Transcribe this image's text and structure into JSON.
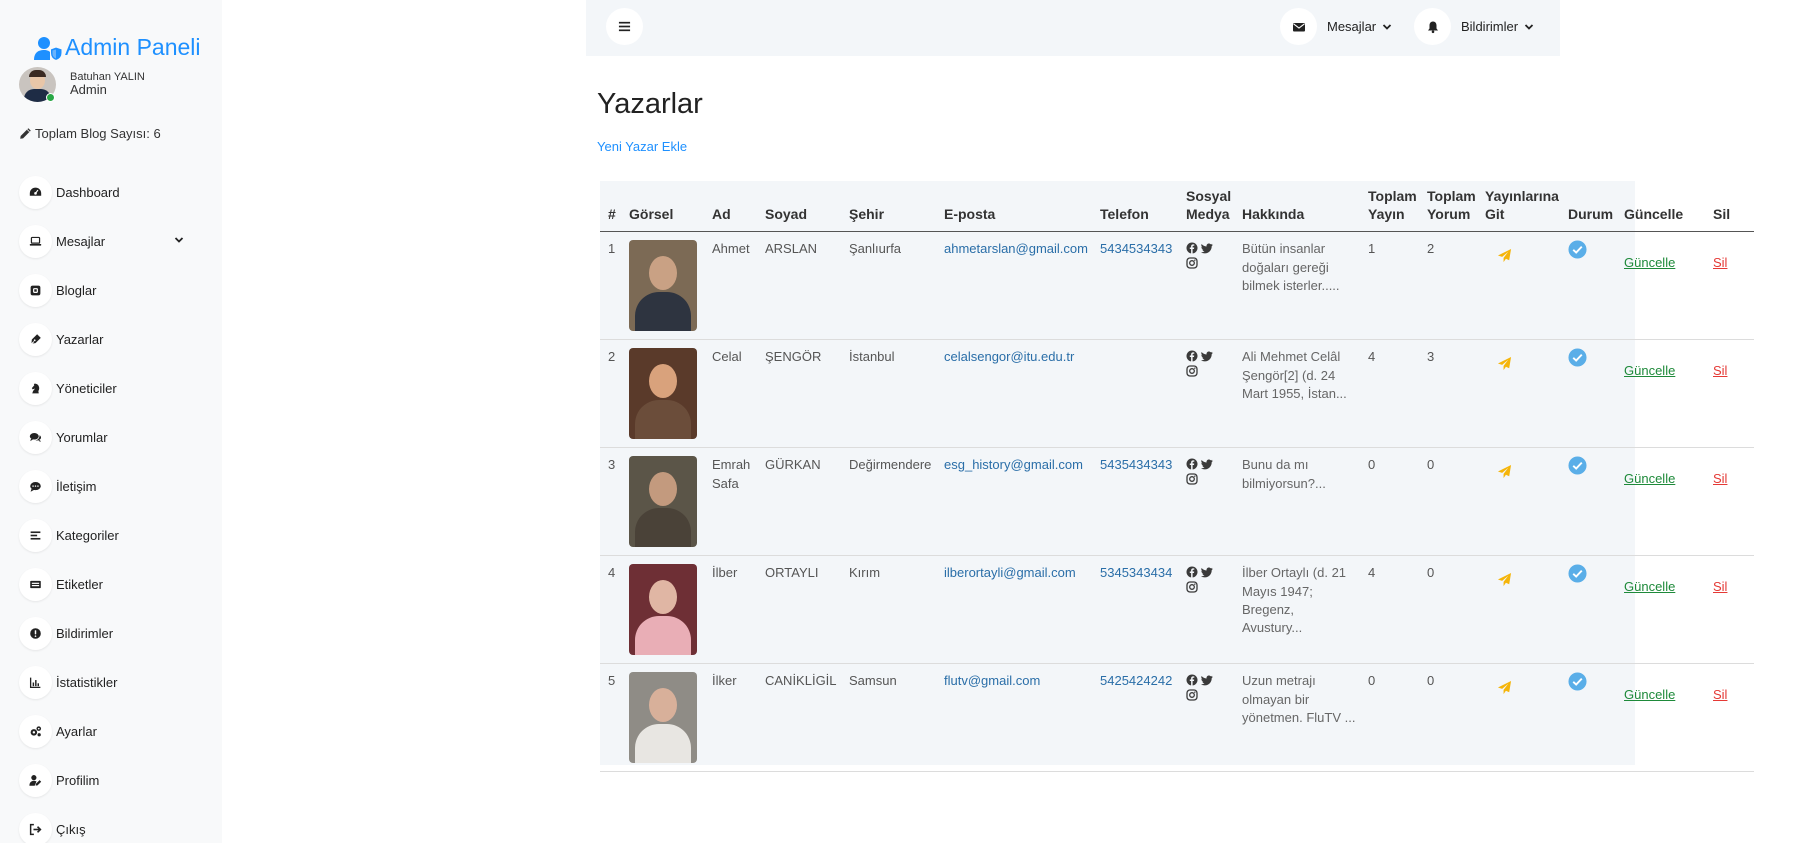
{
  "sidebar": {
    "brand": "Admin Paneli",
    "user": {
      "name": "Batuhan YALIN",
      "role": "Admin"
    },
    "blog_count": "Toplam Blog Sayısı: 6",
    "items": [
      {
        "label": "Dashboard",
        "icon": "dashboard-icon"
      },
      {
        "label": "Mesajlar",
        "icon": "laptop-icon",
        "has_chevron": true
      },
      {
        "label": "Bloglar",
        "icon": "blog-icon"
      },
      {
        "label": "Yazarlar",
        "icon": "pen-icon"
      },
      {
        "label": "Yöneticiler",
        "icon": "chess-knight-icon"
      },
      {
        "label": "Yorumlar",
        "icon": "comments-icon"
      },
      {
        "label": "İletişim",
        "icon": "chat-icon"
      },
      {
        "label": "Kategoriler",
        "icon": "list-icon"
      },
      {
        "label": "Etiketler",
        "icon": "tag-icon"
      },
      {
        "label": "Bildirimler",
        "icon": "alert-icon"
      },
      {
        "label": "İstatistikler",
        "icon": "chart-icon"
      },
      {
        "label": "Ayarlar",
        "icon": "gears-icon"
      },
      {
        "label": "Profilim",
        "icon": "user-edit-icon"
      },
      {
        "label": "Çıkış",
        "icon": "logout-icon"
      }
    ]
  },
  "topbar": {
    "messages_label": "Mesajlar",
    "notifications_label": "Bildirimler"
  },
  "main": {
    "title": "Yazarlar",
    "add_link": "Yeni Yazar Ekle",
    "table": {
      "headers": [
        "#",
        "Görsel",
        "Ad",
        "Soyad",
        "Şehir",
        "E-posta",
        "Telefon",
        "Sosyal Medya",
        "Hakkında",
        "Toplam Yayın",
        "Toplam Yorum",
        "Yayınlarına Git",
        "Durum",
        "Güncelle",
        "Sil"
      ],
      "rows": [
        {
          "no": "1",
          "first": "Ahmet",
          "last": "ARSLAN",
          "city": "Şanlıurfa",
          "email": "ahmetarslan@gmail.com",
          "phone": "5434534343",
          "about": "Bütün insanlar doğaları gereği bilmek isterler.....",
          "posts": "1",
          "comments": "2",
          "update": "Güncelle",
          "delete": "Sil"
        },
        {
          "no": "2",
          "first": "Celal",
          "last": "ŞENGÖR",
          "city": "İstanbul",
          "email": "celalsengor@itu.edu.tr",
          "phone": "",
          "about": "Ali Mehmet Celâl Şengör[2] (d. 24 Mart 1955, İstan...",
          "posts": "4",
          "comments": "3",
          "update": "Güncelle",
          "delete": "Sil"
        },
        {
          "no": "3",
          "first": "Emrah Safa",
          "last": "GÜRKAN",
          "city": "Değirmendere",
          "email": "esg_history@gmail.com",
          "phone": "5435434343",
          "about": "Bunu da mı bilmiyorsun?...",
          "posts": "0",
          "comments": "0",
          "update": "Güncelle",
          "delete": "Sil"
        },
        {
          "no": "4",
          "first": "İlber",
          "last": "ORTAYLI",
          "city": "Kırım",
          "email": "ilberortayli@gmail.com",
          "phone": "5345343434",
          "about": "İlber Ortaylı (d. 21 Mayıs 1947; Bregenz, Avustury...",
          "posts": "4",
          "comments": "0",
          "update": "Güncelle",
          "delete": "Sil"
        },
        {
          "no": "5",
          "first": "İlker",
          "last": "CANİKLİGİL",
          "city": "Samsun",
          "email": "flutv@gmail.com",
          "phone": "5425424242",
          "about": "Uzun metrajı olmayan bir yönetmen. FluTV ...",
          "posts": "0",
          "comments": "0",
          "update": "Güncelle",
          "delete": "Sil"
        }
      ]
    }
  },
  "colors": {
    "accent": "#1e90ff",
    "update": "#1e8a3a",
    "delete": "#e53935",
    "status_check": "#5aaee8",
    "go_posts": "#f5b50a",
    "topbar_bg": "#f3f6f9"
  }
}
